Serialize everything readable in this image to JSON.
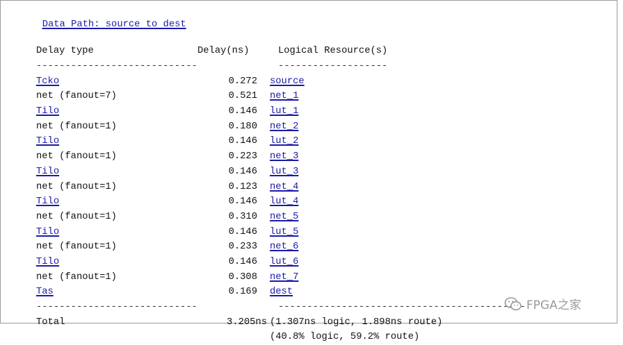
{
  "title": "Data Path: source to dest",
  "columns": {
    "type": "Delay type",
    "delay": "Delay(ns)",
    "resource": "Logical Resource(s)"
  },
  "separators": {
    "type": "----------------------------",
    "resource_short": "-------------------",
    "resource_long": "-------------------------------------------"
  },
  "rows": [
    {
      "type": "Tcko",
      "type_link": true,
      "delay": "0.272",
      "resource": "source"
    },
    {
      "type": "net (fanout=7)",
      "type_link": false,
      "delay": "0.521",
      "resource": "net_1"
    },
    {
      "type": "Tilo",
      "type_link": true,
      "delay": "0.146",
      "resource": "lut_1"
    },
    {
      "type": "net (fanout=1)",
      "type_link": false,
      "delay": "0.180",
      "resource": "net_2"
    },
    {
      "type": "Tilo",
      "type_link": true,
      "delay": "0.146",
      "resource": "lut_2"
    },
    {
      "type": "net (fanout=1)",
      "type_link": false,
      "delay": "0.223",
      "resource": "net_3"
    },
    {
      "type": "Tilo",
      "type_link": true,
      "delay": "0.146",
      "resource": "lut_3"
    },
    {
      "type": "net (fanout=1)",
      "type_link": false,
      "delay": "0.123",
      "resource": "net_4"
    },
    {
      "type": "Tilo",
      "type_link": true,
      "delay": "0.146",
      "resource": "lut_4"
    },
    {
      "type": "net (fanout=1)",
      "type_link": false,
      "delay": "0.310",
      "resource": "net_5"
    },
    {
      "type": "Tilo",
      "type_link": true,
      "delay": "0.146",
      "resource": "lut_5"
    },
    {
      "type": "net (fanout=1)",
      "type_link": false,
      "delay": "0.233",
      "resource": "net_6"
    },
    {
      "type": "Tilo",
      "type_link": true,
      "delay": "0.146",
      "resource": "lut_6"
    },
    {
      "type": "net (fanout=1)",
      "type_link": false,
      "delay": "0.308",
      "resource": "net_7"
    },
    {
      "type": "Tas",
      "type_link": true,
      "delay": "0.169",
      "resource": "dest"
    }
  ],
  "total": {
    "label": "Total",
    "delay": "3.205ns",
    "breakdown_ns": "(1.307ns logic, 1.898ns route)",
    "breakdown_pct": "(40.8% logic, 59.2% route)"
  },
  "watermark": {
    "text": "FPGA之家",
    "icon": "wechat-icon"
  }
}
